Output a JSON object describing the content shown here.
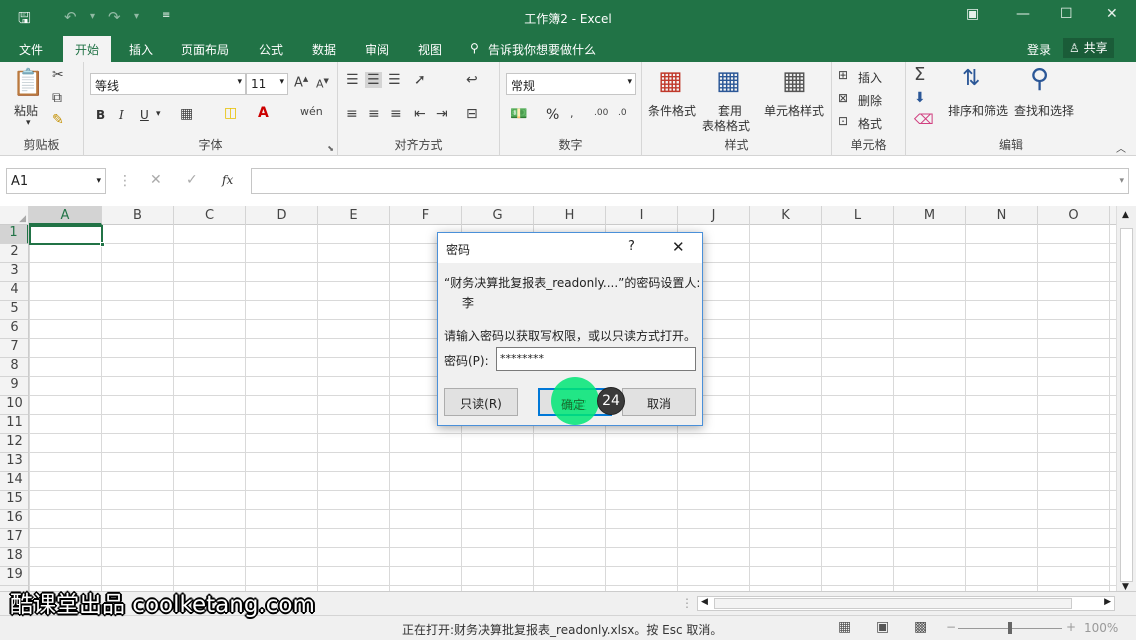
{
  "titlebar": {
    "title": "工作簿2 - Excel",
    "save_icon": "floppy-disk-icon"
  },
  "tabs": [
    {
      "label": "文件"
    },
    {
      "label": "开始"
    },
    {
      "label": "插入"
    },
    {
      "label": "页面布局"
    },
    {
      "label": "公式"
    },
    {
      "label": "数据"
    },
    {
      "label": "审阅"
    },
    {
      "label": "视图"
    }
  ],
  "tellme": "告诉我你想要做什么",
  "login": "登录",
  "share": "共享",
  "ribbon": {
    "clipboard": {
      "label": "剪贴板",
      "paste": "粘贴"
    },
    "font": {
      "label": "字体",
      "font_name": "等线",
      "font_size": "11",
      "bold": "B",
      "italic": "I",
      "underline": "U"
    },
    "align": {
      "label": "对齐方式"
    },
    "number": {
      "label": "数字",
      "format": "常规",
      "percent": "%"
    },
    "styles": {
      "label": "样式",
      "conditional": "条件格式",
      "table_fmt_1": "套用",
      "table_fmt_2": "表格格式",
      "cell_styles": "单元格样式"
    },
    "cells": {
      "label": "单元格",
      "insert": "插入",
      "delete": "删除",
      "format": "格式"
    },
    "editing": {
      "label": "编辑",
      "sort": "排序和筛选",
      "find": "查找和选择"
    }
  },
  "namebox": "A1",
  "fx": "fx",
  "columns": [
    "A",
    "B",
    "C",
    "D",
    "E",
    "F",
    "G",
    "H",
    "I",
    "J",
    "K",
    "L",
    "M",
    "N",
    "O"
  ],
  "rows": [
    "1",
    "2",
    "3",
    "4",
    "5",
    "6",
    "7",
    "8",
    "9",
    "10",
    "11",
    "12",
    "13",
    "14",
    "15",
    "16",
    "17",
    "18",
    "19"
  ],
  "dialog": {
    "title": "密码",
    "help": "?",
    "message": "“财务决算批复报表_readonly....”的密码设置人:",
    "owner": "李",
    "prompt": "请输入密码以获取写权限，或以只读方式打开。",
    "password_label": "密码(P):",
    "password_value": "********",
    "readonly_button": "只读(R)",
    "ok_button": "确定",
    "cancel_button": "取消",
    "step_badge": "24"
  },
  "status_text": "正在打开:财务决算批复报表_readonly.xlsx。按 Esc 取消。",
  "zoom": "100%",
  "watermark": "酷课堂出品 coolketang.com",
  "colors": {
    "excel_green": "#217346",
    "highlight": "#00e676",
    "dialog_border": "#4a90d9"
  }
}
